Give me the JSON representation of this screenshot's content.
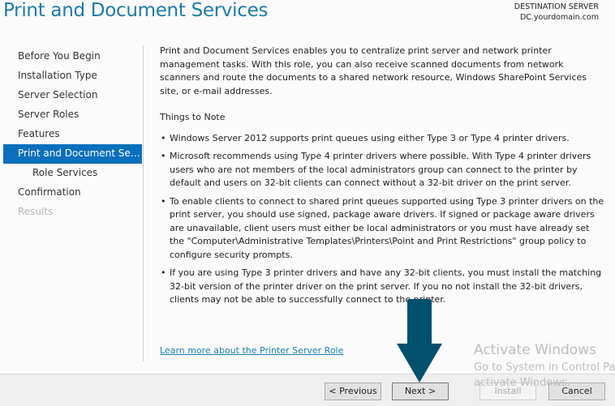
{
  "header": {
    "title": "Print and Document Services",
    "destination_label": "DESTINATION SERVER",
    "destination_value": "DC.yourdomain.com"
  },
  "sidebar": {
    "items": [
      {
        "label": "Before You Begin",
        "state": "normal"
      },
      {
        "label": "Installation Type",
        "state": "normal"
      },
      {
        "label": "Server Selection",
        "state": "normal"
      },
      {
        "label": "Server Roles",
        "state": "normal"
      },
      {
        "label": "Features",
        "state": "normal"
      },
      {
        "label": "Print and Document Servi...",
        "state": "active"
      },
      {
        "label": "Role Services",
        "state": "sub"
      },
      {
        "label": "Confirmation",
        "state": "normal"
      },
      {
        "label": "Results",
        "state": "disabled"
      }
    ]
  },
  "content": {
    "intro": "Print and Document Services enables you to centralize print server and network printer management tasks. With this role, you can also receive scanned documents from network scanners and route the documents to a shared network resource, Windows SharePoint Services site, or e-mail addresses.",
    "things_heading": "Things to Note",
    "bullet_glyph": "•",
    "notes": [
      "Windows Server 2012 supports print queues using either Type 3 or Type 4 printer drivers.",
      "Microsoft recommends using Type 4 printer drivers where possible. With Type 4 printer drivers users who are not members of the local administrators group can connect to the printer by default and users on 32-bit clients can connect without a 32-bit driver on the print server.",
      "To enable clients to connect to shared print queues supported using Type 3 printer drivers on the print server, you should use signed, package aware drivers. If signed or package aware drivers are unavailable, client users must either be local administrators or you must have already set the \"Computer\\Administrative Templates\\Printers\\Point and Print Restrictions\" group policy to configure security prompts.",
      "If you are using Type 3 printer drivers and have any 32-bit clients, you must install the matching 32-bit version of the printer driver on the print server. If you no not install the 32-bit drivers, clients may not be able to successfully connect to the printer."
    ],
    "learn_more_link": "Learn more about the Printer Server Role"
  },
  "footer": {
    "previous_label": "< Previous",
    "next_label": "Next >",
    "install_label": "Install",
    "cancel_label": "Cancel"
  },
  "annotation": {
    "arrow_color": "#00506e",
    "points_to": "Next >"
  },
  "watermark": {
    "line1": "Activate Windows",
    "line2": "Go to System in Control Pa",
    "line3": "activate Windows."
  },
  "colors": {
    "title": "#1c7ca8",
    "active_nav": "#0a6fbd",
    "link": "#1a7db0"
  }
}
